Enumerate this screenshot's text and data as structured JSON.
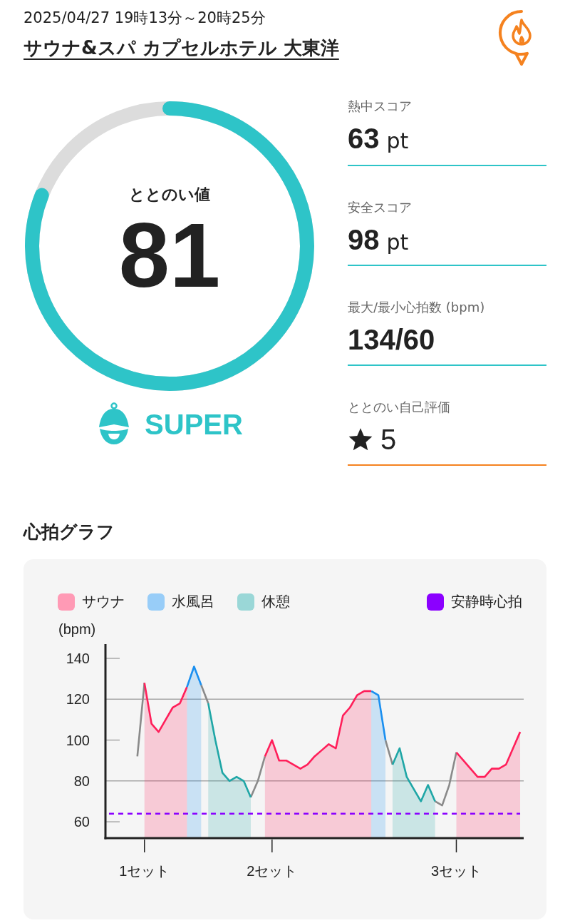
{
  "header": {
    "datetime": "2025/04/27 19時13分～20時25分",
    "facility": "サウナ&スパ カプセルホテル 大東洋"
  },
  "gauge": {
    "label": "ととのい値",
    "value": "81",
    "level": 0.81,
    "rank": "SUPER"
  },
  "metrics": [
    {
      "kind": "score",
      "label": "熱中スコア",
      "value": "63",
      "unit": "pt",
      "color": "#2ec4c8"
    },
    {
      "kind": "score",
      "label": "安全スコア",
      "value": "98",
      "unit": "pt",
      "color": "#2ec4c8"
    },
    {
      "kind": "score",
      "label": "最大/最小心拍数 (bpm)",
      "value": "134/60",
      "color": "#2ec4c8"
    },
    {
      "kind": "rating",
      "label": "ととのい自己評価",
      "value": "5",
      "color": "#f5821f"
    }
  ],
  "heart_rate": {
    "title": "心拍グラフ",
    "chart_data": {
      "type": "area",
      "ylabel": "(bpm)",
      "ylim": [
        52,
        147
      ],
      "yticks": [
        60,
        80,
        100,
        120,
        140
      ],
      "categories": [
        null,
        null,
        null,
        null,
        null,
        "1セット",
        null,
        null,
        null,
        null,
        null,
        null,
        null,
        null,
        null,
        null,
        null,
        null,
        null,
        null,
        null,
        null,
        null,
        "2セット",
        null,
        null,
        null,
        null,
        null,
        null,
        null,
        null,
        null,
        null,
        null,
        null,
        null,
        null,
        null,
        null,
        null,
        null,
        null,
        null,
        null,
        null,
        null,
        null,
        null,
        "3セット",
        null,
        null,
        null,
        null,
        null,
        null,
        null,
        null,
        null
      ],
      "series": [
        {
          "type": "line",
          "color": "#8a8a8a",
          "values": [
            null,
            null,
            null,
            null,
            92,
            128,
            null,
            null,
            null,
            null,
            null,
            null,
            null,
            127,
            118,
            null,
            null,
            null,
            null,
            null,
            72,
            80,
            92,
            null,
            null,
            null,
            null,
            null,
            null,
            null,
            null,
            null,
            null,
            null,
            null,
            null,
            null,
            null,
            null,
            100,
            88,
            null,
            null,
            null,
            null,
            null,
            70,
            68,
            78,
            94,
            null,
            null,
            null,
            null,
            null,
            null,
            null,
            null,
            null
          ]
        },
        {
          "name": "サウナ",
          "color": "#ff1f5a",
          "values": [
            null,
            null,
            null,
            null,
            null,
            128,
            108,
            104,
            110,
            116,
            118,
            126,
            null,
            null,
            null,
            null,
            null,
            null,
            null,
            null,
            null,
            null,
            92,
            100,
            90,
            90,
            88,
            86,
            88,
            92,
            95,
            98,
            96,
            112,
            116,
            122,
            124,
            124,
            null,
            null,
            null,
            null,
            null,
            null,
            null,
            null,
            null,
            null,
            null,
            94,
            90,
            86,
            82,
            82,
            86,
            86,
            88,
            96,
            104
          ]
        },
        {
          "name": "水風呂",
          "color": "#1a8ff0",
          "values": [
            null,
            null,
            null,
            null,
            null,
            null,
            null,
            null,
            null,
            null,
            null,
            126,
            136,
            127,
            null,
            null,
            null,
            null,
            null,
            null,
            null,
            null,
            null,
            null,
            null,
            null,
            null,
            null,
            null,
            null,
            null,
            null,
            null,
            null,
            null,
            null,
            null,
            124,
            122,
            100,
            null,
            null,
            null,
            null,
            null,
            null,
            null,
            null,
            null,
            null,
            null,
            null,
            null,
            null,
            null,
            null,
            null,
            null,
            null
          ]
        },
        {
          "name": "休憩",
          "color": "#1fa6a6",
          "values": [
            null,
            null,
            null,
            null,
            null,
            null,
            null,
            null,
            null,
            null,
            null,
            null,
            null,
            null,
            118,
            100,
            84,
            80,
            82,
            80,
            72,
            null,
            null,
            null,
            null,
            null,
            null,
            null,
            null,
            null,
            null,
            null,
            null,
            null,
            null,
            null,
            null,
            null,
            null,
            null,
            88,
            96,
            82,
            76,
            70,
            78,
            70,
            null,
            null,
            null,
            null,
            null,
            null,
            null,
            null,
            null,
            null,
            null,
            null
          ]
        },
        {
          "name": "安静時心拍",
          "type": "line",
          "line_style": "dashed",
          "color": "#8b00ff",
          "values": [
            64,
            64,
            64,
            64,
            64,
            64,
            64,
            64,
            64,
            64,
            64,
            64,
            64,
            64,
            64,
            64,
            64,
            64,
            64,
            64,
            64,
            64,
            64,
            64,
            64,
            64,
            64,
            64,
            64,
            64,
            64,
            64,
            64,
            64,
            64,
            64,
            64,
            64,
            64,
            64,
            64,
            64,
            64,
            64,
            64,
            64,
            64,
            64,
            64,
            64,
            64,
            64,
            64,
            64,
            64,
            64,
            64,
            64,
            64
          ]
        }
      ]
    }
  }
}
